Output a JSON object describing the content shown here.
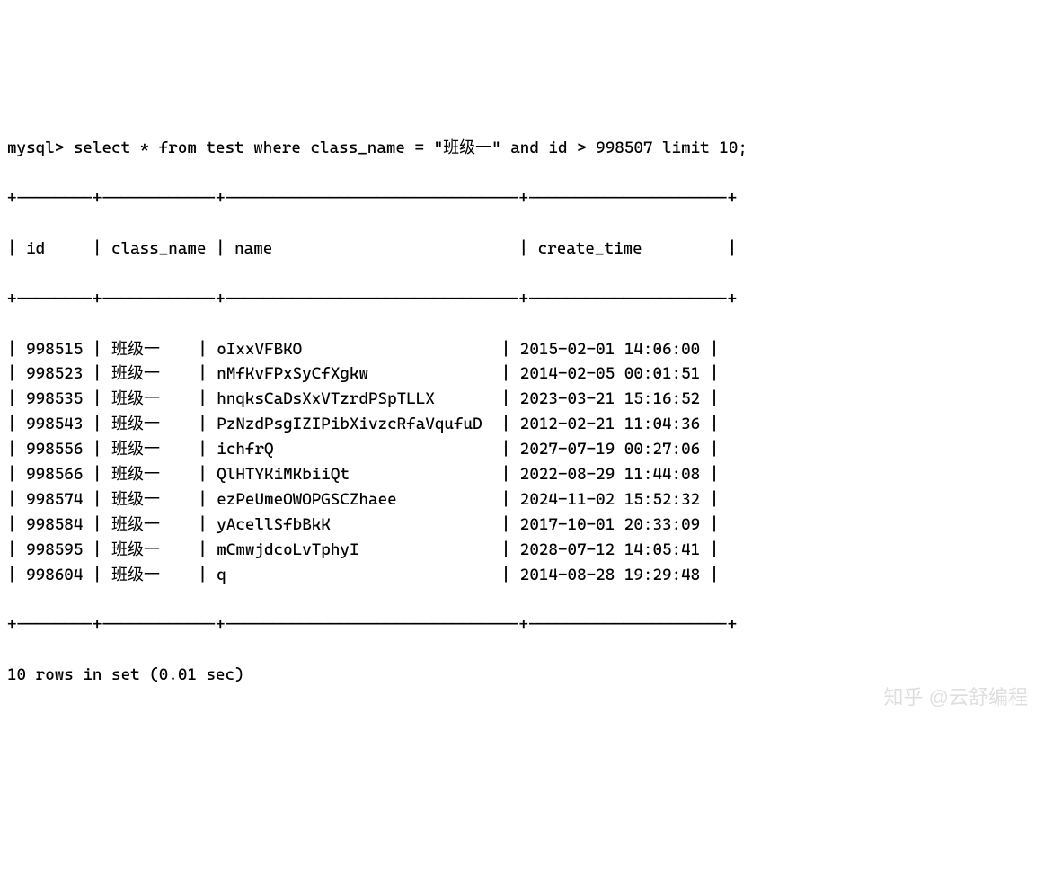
{
  "prompt": "mysql>",
  "query": "select * from test where class_name = \"班级一\" and id > 998507 limit 10;",
  "border_top": "+--------+------------+-------------------------------+---------------------+",
  "header_line": "| id     | class_name | name                          | create_time         |",
  "border_mid": "+--------+------------+-------------------------------+---------------------+",
  "chart_data": {
    "type": "table",
    "columns": [
      "id",
      "class_name",
      "name",
      "create_time"
    ],
    "rows": [
      {
        "id": "998515",
        "class_name": "班级一",
        "name": "oIxxVFBKO",
        "create_time": "2015-02-01 14:06:00"
      },
      {
        "id": "998523",
        "class_name": "班级一",
        "name": "nMfKvFPxSyCfXgkw",
        "create_time": "2014-02-05 00:01:51"
      },
      {
        "id": "998535",
        "class_name": "班级一",
        "name": "hnqksCaDsXxVTzrdPSpTLLX",
        "create_time": "2023-03-21 15:16:52"
      },
      {
        "id": "998543",
        "class_name": "班级一",
        "name": "PzNzdPsgIZIPibXivzcRfaVqufuD",
        "create_time": "2012-02-21 11:04:36"
      },
      {
        "id": "998556",
        "class_name": "班级一",
        "name": "ichfrQ",
        "create_time": "2027-07-19 00:27:06"
      },
      {
        "id": "998566",
        "class_name": "班级一",
        "name": "QlHTYKiMKbiiQt",
        "create_time": "2022-08-29 11:44:08"
      },
      {
        "id": "998574",
        "class_name": "班级一",
        "name": "ezPeUmeOWOPGSCZhaee",
        "create_time": "2024-11-02 15:52:32"
      },
      {
        "id": "998584",
        "class_name": "班级一",
        "name": "yAcellSfbBkK",
        "create_time": "2017-10-01 20:33:09"
      },
      {
        "id": "998595",
        "class_name": "班级一",
        "name": "mCmwjdcoLvTphyI",
        "create_time": "2028-07-12 14:05:41"
      },
      {
        "id": "998604",
        "class_name": "班级一",
        "name": "q",
        "create_time": "2014-08-28 19:29:48"
      }
    ]
  },
  "border_bot": "+--------+------------+-------------------------------+---------------------+",
  "footer": "10 rows in set (0.01 sec)",
  "watermark": "知乎 @云舒编程"
}
